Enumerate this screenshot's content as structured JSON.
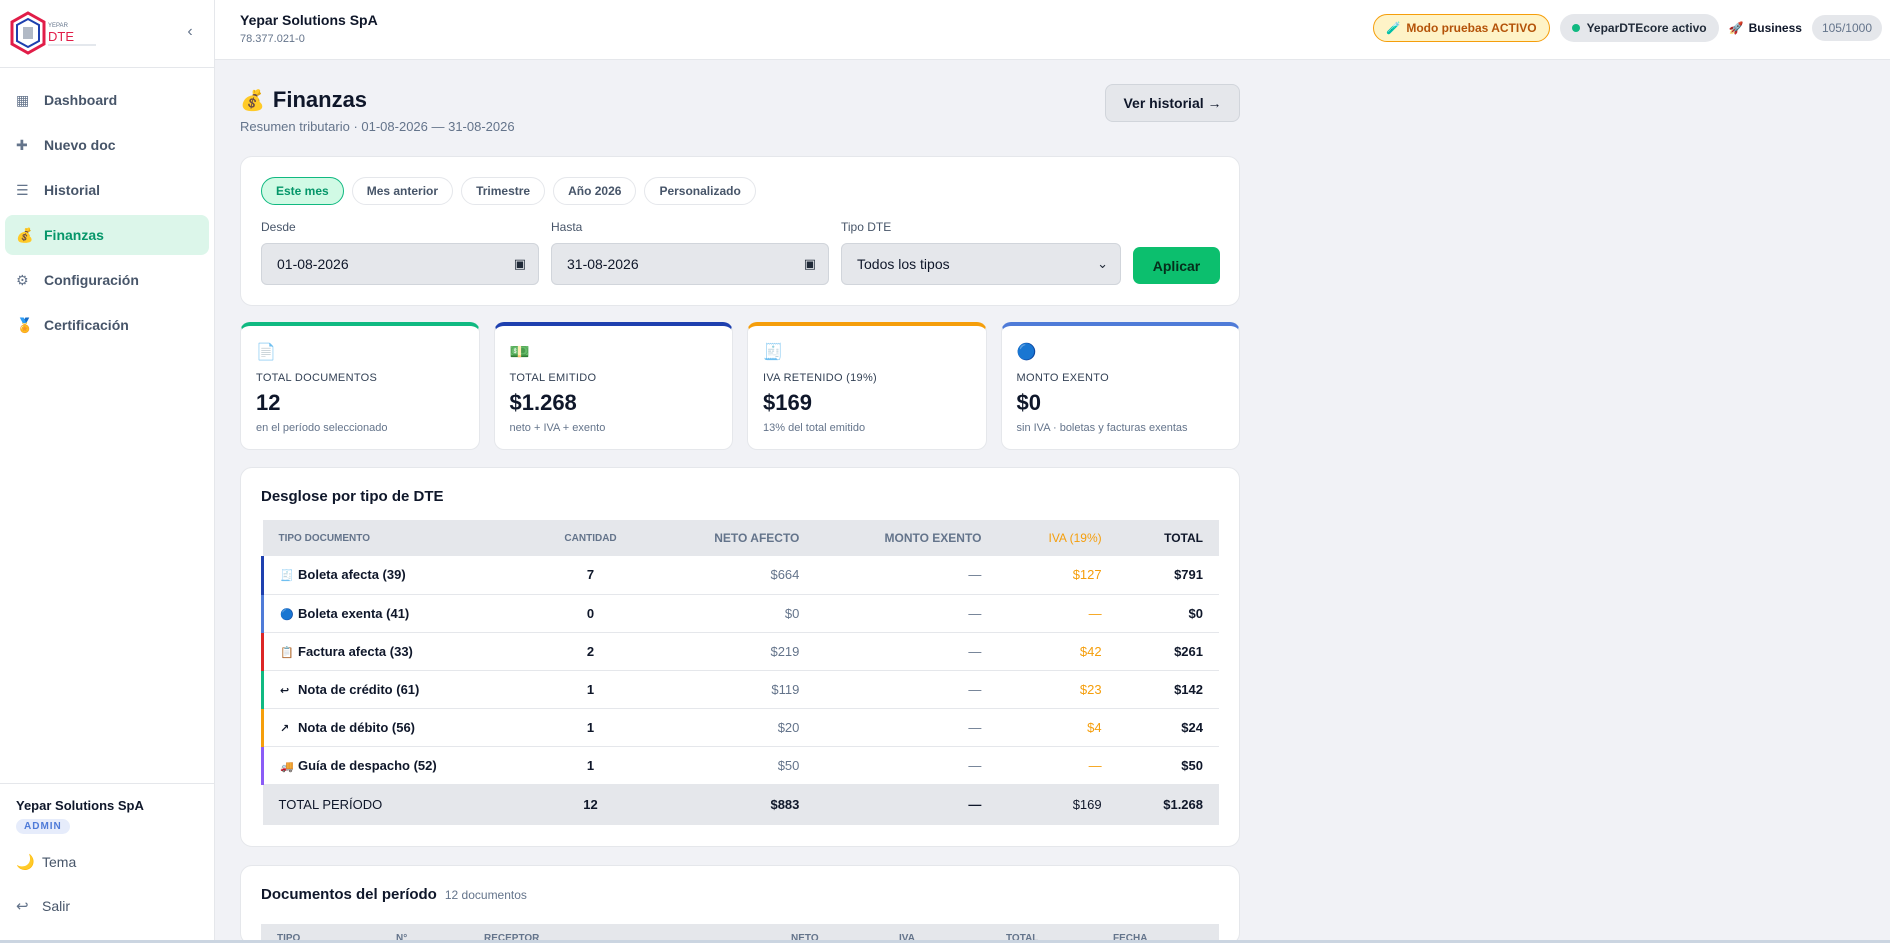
{
  "sidebar": {
    "logo_text": "DTE",
    "logo_brand": "YEPAR",
    "items": [
      {
        "label": "Dashboard",
        "icon": "▦"
      },
      {
        "label": "Nuevo doc",
        "icon": "✚"
      },
      {
        "label": "Historial",
        "icon": "☰"
      },
      {
        "label": "Finanzas",
        "icon": "💰"
      },
      {
        "label": "Configuración",
        "icon": "⚙"
      },
      {
        "label": "Certificación",
        "icon": "🏅"
      }
    ],
    "collapse_icon": "‹",
    "footer": {
      "company": "Yepar Solutions SpA",
      "role": "ADMIN",
      "theme_label": "Tema",
      "theme_icon": "🌙",
      "logout_label": "Salir",
      "logout_icon": "↩"
    }
  },
  "topbar": {
    "company": "Yepar Solutions SpA",
    "rut": "78.377.021-0",
    "test_mode": "Modo pruebas ACTIVO",
    "test_icon": "🧪",
    "core_status": "YeparDTEcore activo",
    "plan": "Business",
    "plan_icon": "🚀",
    "quota": "105/1000"
  },
  "page": {
    "icon": "💰",
    "title": "Finanzas",
    "subtitle": "Resumen tributario · 01-08-2026 — 31-08-2026",
    "history_button": "Ver historial →"
  },
  "filters": {
    "chips": [
      "Este mes",
      "Mes anterior",
      "Trimestre",
      "Año 2026",
      "Personalizado"
    ],
    "from_label": "Desde",
    "from_value": "01-08-2026",
    "to_label": "Hasta",
    "to_value": "31-08-2026",
    "type_label": "Tipo DTE",
    "type_value": "Todos los tipos",
    "apply": "Aplicar"
  },
  "kpis": [
    {
      "icon": "📄",
      "label": "TOTAL DOCUMENTOS",
      "value": "12",
      "note": "en el período seleccionado",
      "color": "#10b981"
    },
    {
      "icon": "💵",
      "label": "TOTAL EMITIDO",
      "value": "$1.268",
      "note": "neto + IVA + exento",
      "color": "#1e40af"
    },
    {
      "icon": "🧾",
      "label": "IVA RETENIDO (19%)",
      "value": "$169",
      "note": "13% del total emitido",
      "color": "#f59e0b"
    },
    {
      "icon": "🔵",
      "label": "MONTO EXENTO",
      "value": "$0",
      "note": "sin IVA · boletas y facturas exentas",
      "color": "#4f7bd8"
    }
  ],
  "breakdown": {
    "title": "Desglose por tipo de DTE",
    "headers": [
      "TIPO DOCUMENTO",
      "CANTIDAD",
      "NETO AFECTO",
      "MONTO EXENTO",
      "IVA (19%)",
      "TOTAL"
    ],
    "rows": [
      {
        "icon": "🧾",
        "type": "Boletа afecta (39)",
        "qty": "7",
        "neto": "$664",
        "exento": "—",
        "iva": "$127",
        "total": "$791",
        "color": "#1e40af"
      },
      {
        "icon": "🔵",
        "type": "Boleta exenta (41)",
        "qty": "0",
        "neto": "$0",
        "exento": "—",
        "iva": "—",
        "total": "$0",
        "color": "#4f7bd8"
      },
      {
        "icon": "📋",
        "type": "Factura afecta (33)",
        "qty": "2",
        "neto": "$219",
        "exento": "—",
        "iva": "$42",
        "total": "$261",
        "color": "#dc2626"
      },
      {
        "icon": "↩",
        "type": "Nota de crédito (61)",
        "qty": "1",
        "neto": "$119",
        "exento": "—",
        "iva": "$23",
        "total": "$142",
        "color": "#10b981"
      },
      {
        "icon": "↗",
        "type": "Nota de débito (56)",
        "qty": "1",
        "neto": "$20",
        "exento": "—",
        "iva": "$4",
        "total": "$24",
        "color": "#f59e0b"
      },
      {
        "icon": "🚚",
        "type": "Guía de despacho (52)",
        "qty": "1",
        "neto": "$50",
        "exento": "—",
        "iva": "—",
        "total": "$50",
        "color": "#8b5cf6"
      }
    ],
    "total": {
      "label": "TOTAL PERÍODO",
      "qty": "12",
      "neto": "$883",
      "exento": "—",
      "iva": "$169",
      "total": "$1.268"
    }
  },
  "documents": {
    "title": "Documentos del período",
    "count": "12 documentos",
    "headers": [
      "TIPO",
      "N°",
      "RECEPTOR",
      "NETO",
      "IVA",
      "TOTAL",
      "FECHA"
    ]
  }
}
